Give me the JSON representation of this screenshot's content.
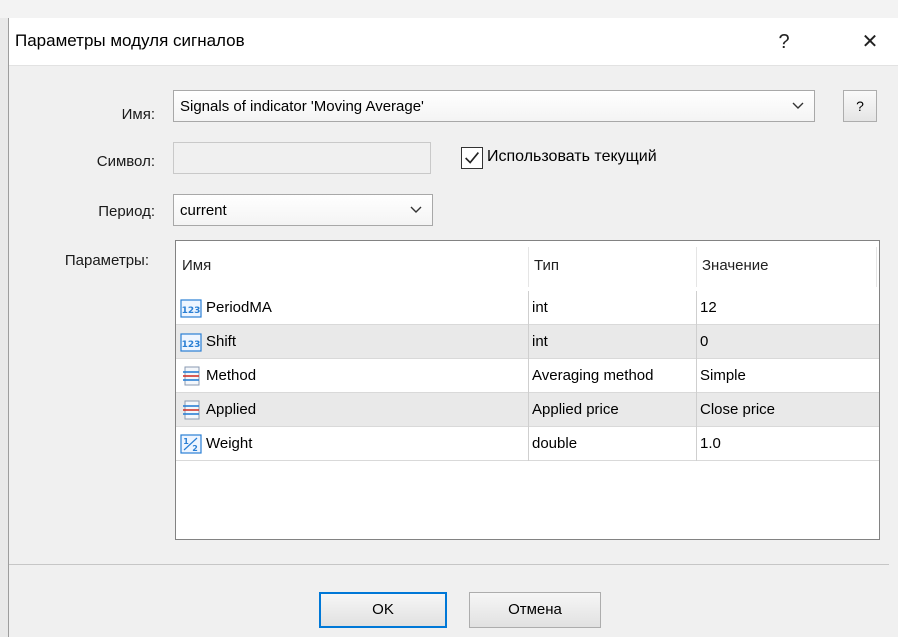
{
  "dialog": {
    "title": "Параметры модуля сигналов",
    "help_glyph": "?",
    "close_glyph": "✕"
  },
  "form": {
    "name_label": "Имя:",
    "name_value": "Signals of indicator 'Moving Average'",
    "name_help": "?",
    "symbol_label": "Символ:",
    "symbol_value": "",
    "use_current_label": "Использовать текущий",
    "use_current_checked": true,
    "period_label": "Период:",
    "period_value": "current",
    "params_label": "Параметры:"
  },
  "table": {
    "headers": [
      "Имя",
      "Тип",
      "Значение"
    ],
    "rows": [
      {
        "icon": "integer-icon",
        "name": "PeriodMA",
        "type": "int",
        "value": "12"
      },
      {
        "icon": "integer-icon",
        "name": "Shift",
        "type": "int",
        "value": "0"
      },
      {
        "icon": "enum-list-icon",
        "name": "Method",
        "type": "Averaging method",
        "value": "Simple"
      },
      {
        "icon": "enum-list-icon",
        "name": "Applied",
        "type": "Applied price",
        "value": "Close price"
      },
      {
        "icon": "fraction-icon",
        "name": "Weight",
        "type": "double",
        "value": "1.0"
      }
    ]
  },
  "buttons": {
    "ok": "OK",
    "cancel": "Отмена"
  },
  "colors": {
    "accent": "#0078d7",
    "icon_blue": "#2a7fd4",
    "icon_red": "#d0342c"
  }
}
